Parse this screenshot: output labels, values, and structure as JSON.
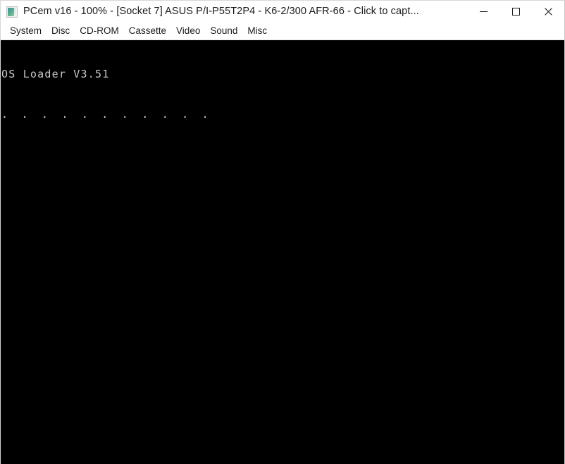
{
  "window": {
    "title": "PCem v16 - 100% - [Socket 7] ASUS P/I-P55T2P4 - K6-2/300 AFR-66 - Click to capt...",
    "icon_name": "pcem-monitor-icon",
    "controls": [
      {
        "name": "minimize-button",
        "icon": "minimize-icon",
        "label": "Minimize"
      },
      {
        "name": "maximize-button",
        "icon": "maximize-icon",
        "label": "Maximize"
      },
      {
        "name": "close-button",
        "icon": "close-icon",
        "label": "Close"
      }
    ]
  },
  "menubar": {
    "items": [
      {
        "label": "System"
      },
      {
        "label": "Disc"
      },
      {
        "label": "CD-ROM"
      },
      {
        "label": "Cassette"
      },
      {
        "label": "Video"
      },
      {
        "label": "Sound"
      },
      {
        "label": "Misc"
      }
    ]
  },
  "screen": {
    "background_color": "#000000",
    "text_color": "#c8c8c8",
    "lines": [
      "OS Loader V3.51",
      ". . . . . . . . . . ."
    ]
  }
}
